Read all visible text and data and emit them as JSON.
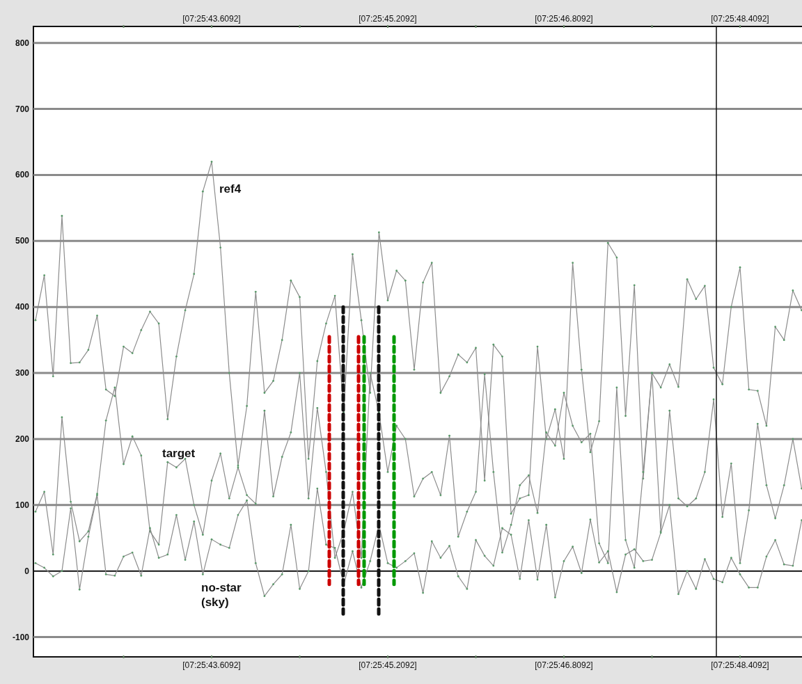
{
  "chart_data": {
    "type": "line",
    "categories": [
      null,
      null,
      null,
      null,
      null,
      null,
      null,
      null,
      null,
      null,
      null,
      null,
      null,
      null,
      null,
      null,
      null,
      null,
      null,
      null,
      "[07:25:43.6092]",
      null,
      null,
      null,
      null,
      null,
      null,
      null,
      null,
      null,
      null,
      null,
      null,
      null,
      null,
      null,
      null,
      null,
      null,
      null,
      "[07:25:45.2092]",
      null,
      null,
      null,
      null,
      null,
      null,
      null,
      null,
      null,
      null,
      null,
      null,
      null,
      null,
      null,
      null,
      null,
      null,
      null,
      "[07:25:46.8092]",
      null,
      null,
      null,
      null,
      null,
      null,
      null,
      null,
      null,
      null,
      null,
      null,
      null,
      null,
      null,
      null,
      null,
      null,
      null,
      "[07:25:48.4092]",
      null,
      null,
      null,
      null,
      null,
      null,
      null
    ],
    "series": [
      {
        "name": "ref4",
        "color": "#8c8c8c",
        "values": [
          380,
          448,
          295,
          538,
          315,
          316,
          335,
          387,
          275,
          265,
          340,
          330,
          365,
          393,
          375,
          230,
          325,
          395,
          450,
          575,
          620,
          490,
          300,
          160,
          250,
          423,
          270,
          288,
          350,
          440,
          415,
          170,
          318,
          375,
          417,
          240,
          480,
          380,
          270,
          513,
          410,
          455,
          440,
          305,
          437,
          467,
          270,
          295,
          328,
          316,
          338,
          137,
          343,
          325,
          87,
          110,
          115,
          340,
          200,
          245,
          170,
          467,
          305,
          180,
          227,
          497,
          475,
          235,
          433,
          140,
          300,
          278,
          313,
          279,
          442,
          412,
          432,
          308,
          283,
          400,
          460,
          275,
          273,
          220,
          370,
          350,
          425,
          395
        ]
      },
      {
        "name": "target",
        "color": "#8c8c8c",
        "values": [
          90,
          120,
          25,
          233,
          105,
          45,
          60,
          117,
          228,
          278,
          162,
          204,
          175,
          60,
          40,
          165,
          157,
          170,
          100,
          55,
          137,
          178,
          110,
          157,
          115,
          102,
          243,
          113,
          173,
          210,
          300,
          110,
          247,
          150,
          20,
          60,
          120,
          20,
          300,
          240,
          150,
          220,
          200,
          113,
          140,
          150,
          115,
          205,
          52,
          90,
          120,
          298,
          150,
          28,
          70,
          130,
          145,
          88,
          210,
          190,
          270,
          220,
          195,
          208,
          42,
          12,
          278,
          47,
          5,
          150,
          300,
          60,
          243,
          110,
          98,
          110,
          150,
          260,
          82,
          163,
          12,
          92,
          223,
          130,
          80,
          130,
          200,
          125
        ]
      },
      {
        "name": "no-star (sky)",
        "color": "#8c8c8c",
        "values": [
          12,
          5,
          -8,
          0,
          95,
          -28,
          52,
          115,
          -5,
          -7,
          22,
          28,
          -7,
          65,
          20,
          25,
          85,
          17,
          75,
          -5,
          48,
          40,
          35,
          85,
          107,
          12,
          -38,
          -20,
          -5,
          70,
          -27,
          0,
          125,
          40,
          35,
          -20,
          30,
          -25,
          15,
          70,
          12,
          5,
          15,
          27,
          -33,
          45,
          20,
          38,
          -8,
          -27,
          47,
          23,
          8,
          65,
          55,
          -12,
          77,
          -13,
          70,
          -40,
          15,
          37,
          -3,
          78,
          13,
          30,
          -32,
          25,
          33,
          15,
          17,
          58,
          100,
          -35,
          0,
          -27,
          18,
          -12,
          -17,
          20,
          -5,
          -25,
          -25,
          22,
          47,
          10,
          8,
          77
        ]
      }
    ],
    "ylim": [
      -130,
      825
    ],
    "grid": true,
    "yticks": [
      -100,
      0,
      100,
      200,
      300,
      400,
      500,
      600,
      700,
      800
    ]
  }
}
